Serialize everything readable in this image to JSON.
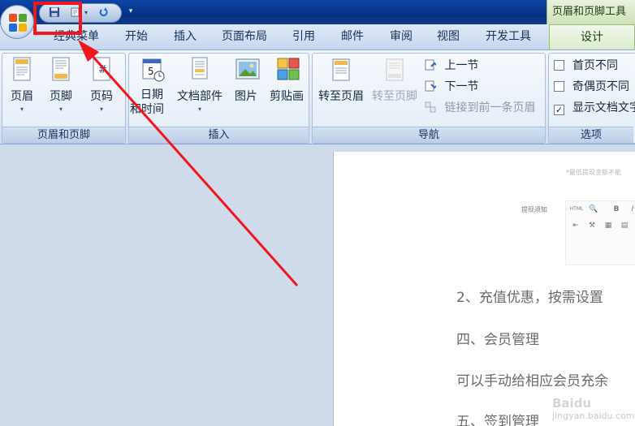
{
  "titlebar": {
    "contextual_title": "页眉和页脚工具"
  },
  "tabs": [
    {
      "label": "经典菜单"
    },
    {
      "label": "开始"
    },
    {
      "label": "插入"
    },
    {
      "label": "页面布局"
    },
    {
      "label": "引用"
    },
    {
      "label": "邮件"
    },
    {
      "label": "审阅"
    },
    {
      "label": "视图"
    },
    {
      "label": "开发工具"
    },
    {
      "label": "设计"
    }
  ],
  "ribbon": {
    "groups": {
      "header_footer": {
        "label": "页眉和页脚",
        "buttons": [
          "页眉",
          "页脚",
          "页码"
        ]
      },
      "insert": {
        "label": "插入",
        "datetime_line1": "日期",
        "datetime_line2": "和时间",
        "doc_parts": "文档部件",
        "picture": "图片",
        "clipart": "剪贴画"
      },
      "navigation": {
        "label": "导航",
        "goto_header": "转至页眉",
        "goto_footer": "转至页脚",
        "prev_section": "上一节",
        "next_section": "下一节",
        "link_previous": "链接到前一条页眉"
      },
      "options": {
        "label": "选项",
        "different_first": "首页不同",
        "different_odd_even": "奇偶页不同",
        "show_doc_text": "显示文档文字",
        "different_first_checked": false,
        "different_odd_even_checked": false,
        "show_doc_text_checked": true
      }
    }
  },
  "document": {
    "note": "*最低提现金额不能",
    "field_label": "提现须知",
    "editor_tools": [
      "HTML",
      "🔍",
      "B",
      "I"
    ],
    "lines": [
      "2、充值优惠，按需设置",
      "四、会员管理",
      "可以手动给相应会员充余",
      "五、签到管理"
    ]
  },
  "watermark": {
    "brand": "Baidu",
    "sub": "jingyan.baidu.com"
  },
  "colors": {
    "annotation_red": "#f0161c",
    "title_blue": "#0d47a8",
    "context_green": "#dbeccb"
  }
}
